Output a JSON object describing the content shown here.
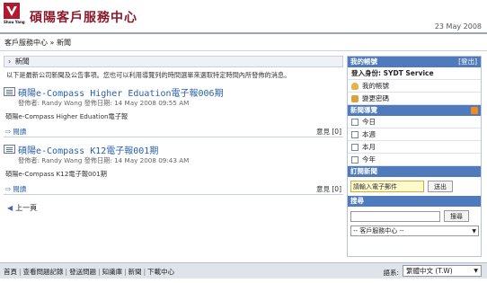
{
  "header": {
    "logo_text": "Shou Yang",
    "site_title": "碩陽客戶服務中心",
    "date": "23 May 2008"
  },
  "breadcrumb": {
    "home": "客戶服務中心",
    "separator": "»",
    "current": "新聞"
  },
  "main": {
    "section_title": "新聞",
    "intro": "以下是最新公司新聞及公告事項。您也可以利用導覽列的時間選單來選取特定時間內所發佈的消息。",
    "posts": [
      {
        "title": "碩陽e-Compass Higher Eduation電子報006期",
        "meta": "發佈者: Randy Wang 發佈日期: 14 May 2008 09:55 AM",
        "excerpt": "碩陽e-Compass Higher Eduation電子報",
        "read_label": "閱讀",
        "comments_label": "意見",
        "comments_count": "[0]"
      },
      {
        "title": "碩陽e-Compass K12電子報001期",
        "meta": "發佈者: Randy Wang 發佈日期: 14 May 2008 09:43 AM",
        "excerpt": "碩陽e-Compass K12電子報001期",
        "read_label": "閱讀",
        "comments_label": "意見",
        "comments_count": "[0]"
      }
    ],
    "prev_page": "上一頁"
  },
  "sidebar": {
    "account": {
      "title": "我的帳號",
      "logout": "[登出]",
      "login_as": "登入身份: SYDT Service",
      "my_account": "我的帳號",
      "change_password": "變更密碼"
    },
    "news_nav": {
      "title": "新聞導覽",
      "items": [
        "今日",
        "本週",
        "本月",
        "今年"
      ]
    },
    "subscribe": {
      "title": "訂閱新聞",
      "email_placeholder": "請輸入電子郵件",
      "button": "送出"
    },
    "search": {
      "title": "搜尋",
      "button": "搜尋",
      "scope": "-- 客戶服務中心 --"
    }
  },
  "footer": {
    "links": [
      "首頁",
      "查看問題記錄",
      "發送問題",
      "知識庫",
      "新聞",
      "下載中心"
    ],
    "language_label": "語系:",
    "language_value": "繁體中文 (T.W)"
  },
  "colors": {
    "brand": "#8a1a2a",
    "link": "#2a5fa8",
    "sidebar_header": "#4f7bbd",
    "rss": "#f08a24"
  }
}
